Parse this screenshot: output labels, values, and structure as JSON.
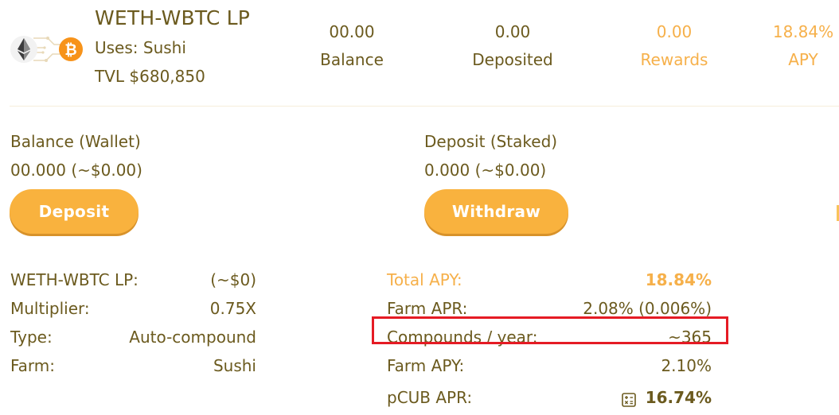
{
  "pool": {
    "title": "WETH-WBTC LP",
    "uses": "Uses: Sushi",
    "tvl": "TVL $680,850",
    "icons": [
      "ethereum-icon",
      "bitcoin-icon"
    ]
  },
  "stats": [
    {
      "value": "00.00",
      "label": "Balance"
    },
    {
      "value": "0.00",
      "label": "Deposited"
    },
    {
      "value": "0.00",
      "label": "Rewards"
    },
    {
      "value": "18.84%",
      "label": "APY"
    }
  ],
  "wallet": {
    "label": "Balance (Wallet)",
    "value": "00.000 (~$0.00)",
    "button": "Deposit"
  },
  "staked": {
    "label": "Deposit (Staked)",
    "value": "0.000 (~$0.00)",
    "button": "Withdraw"
  },
  "details": [
    {
      "key": "WETH-WBTC LP:",
      "value": "(~$0)"
    },
    {
      "key": "Multiplier:",
      "value": "0.75X"
    },
    {
      "key": "Type:",
      "value": "Auto-compound"
    },
    {
      "key": "Farm:",
      "value": "Sushi"
    }
  ],
  "apy": [
    {
      "key": "Total APY:",
      "value": "18.84%"
    },
    {
      "key": "Farm APR:",
      "value": "2.08% (0.006%)"
    },
    {
      "key": "Compounds / year:",
      "value": "~365"
    },
    {
      "key": "Farm APY:",
      "value": "2.10%"
    },
    {
      "key": "pCUB APR:",
      "value": "16.74%"
    }
  ],
  "colors": {
    "text": "#6b5a1e",
    "accent": "#f6b04a",
    "button": "#f9b23e",
    "highlight": "#e51b24"
  }
}
